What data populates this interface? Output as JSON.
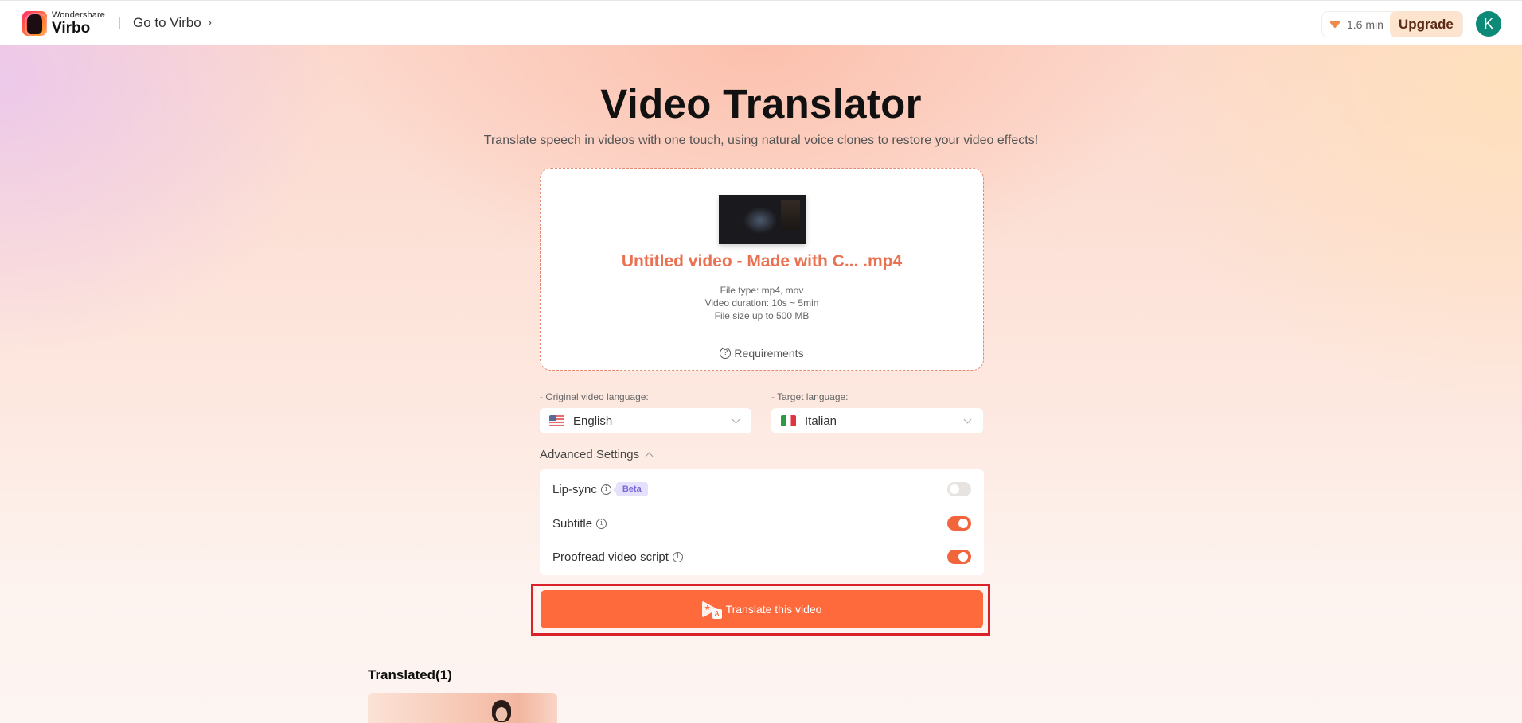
{
  "header": {
    "brand": "Wondershare",
    "product": "Virbo",
    "goto_label": "Go to Virbo",
    "credits": "1.6 min",
    "upgrade_label": "Upgrade",
    "avatar_initial": "K"
  },
  "page": {
    "title": "Video Translator",
    "subtitle": "Translate speech in videos with one touch, using natural voice clones to restore your video effects!"
  },
  "upload": {
    "filename": "Untitled video - Made with C... .mp4",
    "file_type": "File type: mp4, mov",
    "duration": "Video duration: 10s ~ 5min",
    "size": "File size up to 500 MB",
    "requirements_label": "Requirements"
  },
  "languages": {
    "original_label": "- Original video language:",
    "original_value": "English",
    "target_label": "- Target language:",
    "target_value": "Italian"
  },
  "advanced": {
    "label": "Advanced Settings",
    "settings": [
      {
        "label": "Lip-sync",
        "badge": "Beta",
        "enabled": false
      },
      {
        "label": "Subtitle",
        "enabled": true
      },
      {
        "label": "Proofread video script",
        "enabled": true
      }
    ]
  },
  "actions": {
    "translate_label": "Translate this video"
  },
  "translated": {
    "title": "Translated(1)"
  },
  "colors": {
    "accent": "#ff6a3d",
    "filename": "#ea7152",
    "upgrade_bg": "#fde4cf",
    "avatar": "#0d8a77",
    "highlight": "#d9222a",
    "beta_bg": "#e5e0fb",
    "beta_text": "#7b68d6"
  }
}
